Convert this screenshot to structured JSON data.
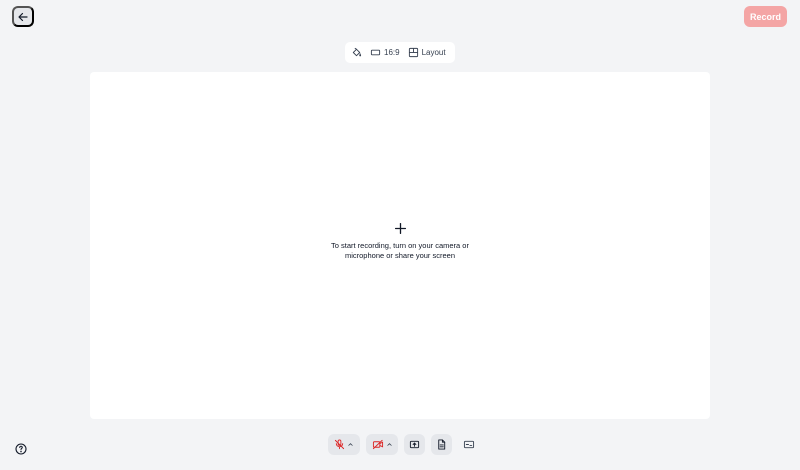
{
  "header": {
    "back_icon": "arrow-left-icon",
    "record_label": "Record",
    "record_color": "#f4a5a5"
  },
  "toolbar": {
    "background_icon": "paint-bucket-icon",
    "aspect_label": "16:9",
    "aspect_icon": "rectangle-icon",
    "layout_label": "Layout",
    "layout_icon": "layout-icon"
  },
  "canvas": {
    "add_icon": "plus-icon",
    "hint": "To start recording, turn on your camera or microphone or share your screen"
  },
  "controls": {
    "mic_icon": "mic-off-icon",
    "camera_icon": "camera-off-icon",
    "share_icon": "share-screen-icon",
    "script_icon": "document-icon",
    "captions_icon": "captions-icon",
    "off_color": "#dc2626"
  },
  "help_icon": "help-icon"
}
